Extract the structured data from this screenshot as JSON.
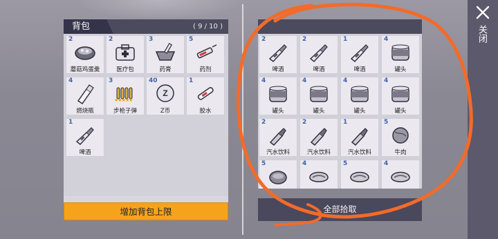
{
  "backpack": {
    "title": "背包",
    "capacity": "( 9 / 10 )",
    "expand_label": "增加背包上限",
    "items": [
      {
        "count": "2",
        "label": "蘑菇鸡蛋羹",
        "icon": "bowl-icon"
      },
      {
        "count": "2",
        "label": "医疗包",
        "icon": "medkit-icon"
      },
      {
        "count": "3",
        "label": "药膏",
        "icon": "mortar-icon"
      },
      {
        "count": "5",
        "label": "药剂",
        "icon": "syringe-icon"
      },
      {
        "count": "4",
        "label": "燃烧瓶",
        "icon": "molotov-icon"
      },
      {
        "count": "3",
        "label": "步枪子弹",
        "icon": "bullets-icon",
        "stars": "★★★★★"
      },
      {
        "count": "40",
        "label": "Z币",
        "icon": "coin-icon"
      },
      {
        "count": "1",
        "label": "胶水",
        "icon": "glue-icon"
      },
      {
        "count": "1",
        "label": "啤酒",
        "icon": "beer-icon"
      }
    ]
  },
  "loot": {
    "take_all_label": "全部拾取",
    "items": [
      {
        "count": "2",
        "label": "啤酒",
        "icon": "beer-icon"
      },
      {
        "count": "2",
        "label": "啤酒",
        "icon": "beer-icon"
      },
      {
        "count": "1",
        "label": "啤酒",
        "icon": "beer-icon"
      },
      {
        "count": "4",
        "label": "罐头",
        "icon": "can-icon"
      },
      {
        "count": "4",
        "label": "罐头",
        "icon": "can-icon"
      },
      {
        "count": "4",
        "label": "罐头",
        "icon": "can-icon"
      },
      {
        "count": "4",
        "label": "罐头",
        "icon": "can-icon"
      },
      {
        "count": "4",
        "label": "罐头",
        "icon": "can-icon"
      },
      {
        "count": "2",
        "label": "汽水饮料",
        "icon": "soda-icon"
      },
      {
        "count": "2",
        "label": "汽水饮料",
        "icon": "soda-icon"
      },
      {
        "count": "1",
        "label": "汽水饮料",
        "icon": "soda-icon"
      },
      {
        "count": "5",
        "label": "牛肉",
        "icon": "beef-icon"
      },
      {
        "count": "5",
        "label": "",
        "icon": "meat-icon"
      },
      {
        "count": "4",
        "label": "",
        "icon": "steak-icon"
      },
      {
        "count": "5",
        "label": "",
        "icon": "steak-icon"
      },
      {
        "count": "4",
        "label": "",
        "icon": "steak-icon"
      }
    ]
  },
  "close": {
    "label": "关闭"
  },
  "colors": {
    "accent_orange": "#f6a31c",
    "count_blue": "#3c63a8",
    "annotation": "#f26b2a"
  }
}
